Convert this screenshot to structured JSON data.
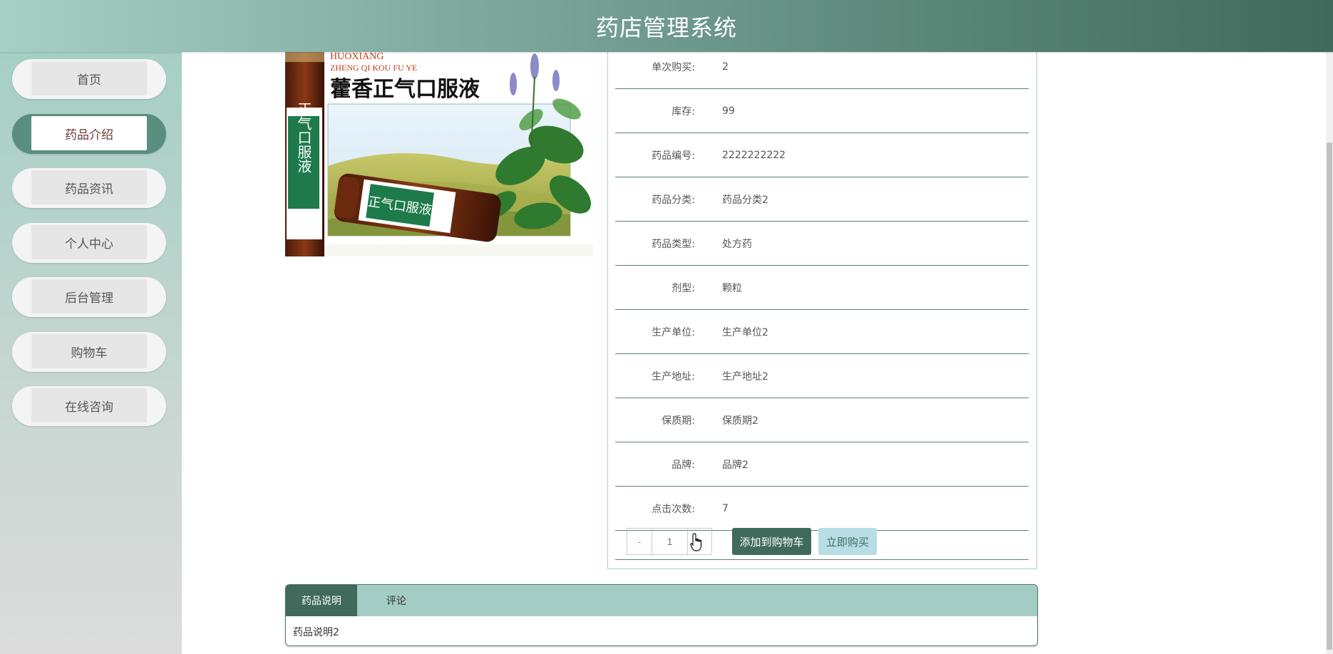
{
  "app": {
    "title": "药店管理系统"
  },
  "sidebar": {
    "items": [
      {
        "label": "首页",
        "active": false
      },
      {
        "label": "药品介绍",
        "active": true
      },
      {
        "label": "药品资讯",
        "active": false
      },
      {
        "label": "个人中心",
        "active": false
      },
      {
        "label": "后台管理",
        "active": false
      },
      {
        "label": "购物车",
        "active": false
      },
      {
        "label": "在线咨询",
        "active": false
      }
    ]
  },
  "product": {
    "image_text": {
      "pinyin_line1": "HUOXIANG",
      "pinyin_line2": "ZHENG QI KOU FU YE",
      "name": "藿香正气口服液"
    },
    "details": [
      {
        "label": "单次购买:",
        "value": "2"
      },
      {
        "label": "库存:",
        "value": "99"
      },
      {
        "label": "药品编号:",
        "value": "2222222222"
      },
      {
        "label": "药品分类:",
        "value": "药品分类2"
      },
      {
        "label": "药品类型:",
        "value": "处方药"
      },
      {
        "label": "剂型:",
        "value": "颗粒"
      },
      {
        "label": "生产单位:",
        "value": "生产单位2"
      },
      {
        "label": "生产地址:",
        "value": "生产地址2"
      },
      {
        "label": "保质期:",
        "value": "保质期2"
      },
      {
        "label": "品牌:",
        "value": "品牌2"
      },
      {
        "label": "点击次数:",
        "value": "7"
      }
    ],
    "quantity": {
      "minus": "-",
      "value": "1"
    },
    "add_to_cart": "添加到购物车",
    "buy_now": "立即购买"
  },
  "tabs": {
    "items": [
      {
        "label": "药品说明",
        "active": true
      },
      {
        "label": "评论",
        "active": false
      }
    ],
    "content": "药品说明2"
  },
  "colors": {
    "header_start": "#a6d0c6",
    "header_end": "#3f6a5c",
    "accent": "#3f6a5c",
    "buy_button": "#b7dde5",
    "tab_bar": "#a3cdc4"
  }
}
